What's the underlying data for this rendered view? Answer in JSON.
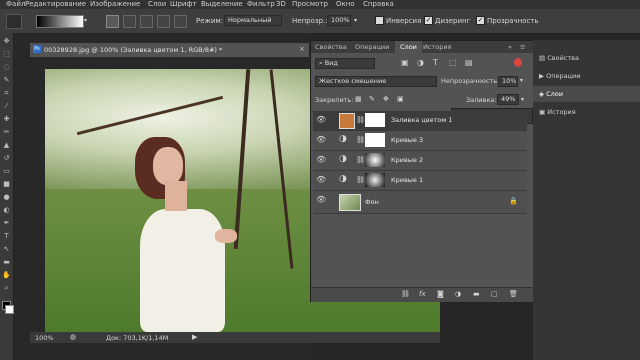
{
  "menu": [
    "Файл",
    "Редактирование",
    "Изображение",
    "Слои",
    "Шрифт",
    "Выделение",
    "Фильтр",
    "3D",
    "Просмотр",
    "Окно",
    "Справка"
  ],
  "options": {
    "mode_label": "Режим:",
    "mode_value": "Нормальный",
    "opacity_label": "Непрозр.:",
    "opacity_value": "100%",
    "inversion_label": "Инверсия",
    "dither_label": "Дизеринг",
    "transparency_label": "Прозрачность"
  },
  "document": {
    "tab_title": "00328928.jpg @ 100% (Заливка цветом 1, RGB/8#) *",
    "zoom": "100%",
    "doc_size": "Док: 703,1K/1,14M"
  },
  "layers_panel": {
    "tabs": [
      "Свойства",
      "Операции",
      "Слои",
      "История"
    ],
    "active_tab": "Слои",
    "filter_value": "Вид",
    "blend_mode": "Жесткое смешение",
    "opacity_label": "Непрозрачность:",
    "opacity_value": "10%",
    "lock_label": "Закрепить:",
    "fill_label": "Заливка:",
    "fill_value": "49%",
    "layers": [
      {
        "name": "Заливка цветом 1",
        "selected": true
      },
      {
        "name": "Кривые 3",
        "selected": false
      },
      {
        "name": "Кривые 2",
        "selected": false
      },
      {
        "name": "Кривые 1",
        "selected": false
      },
      {
        "name": "Фон",
        "selected": false
      }
    ],
    "bottom_icons": [
      "link-icon",
      "fx-icon",
      "mask-icon",
      "adjustment-icon",
      "group-icon",
      "new-layer-icon",
      "trash-icon"
    ]
  },
  "right_panel": {
    "items": [
      "Свойства",
      "Операции",
      "Слои",
      "История"
    ],
    "active": "Слои"
  },
  "colors": {
    "fill_swatch": "#c87a3c",
    "accent": "#2f6fd0"
  }
}
